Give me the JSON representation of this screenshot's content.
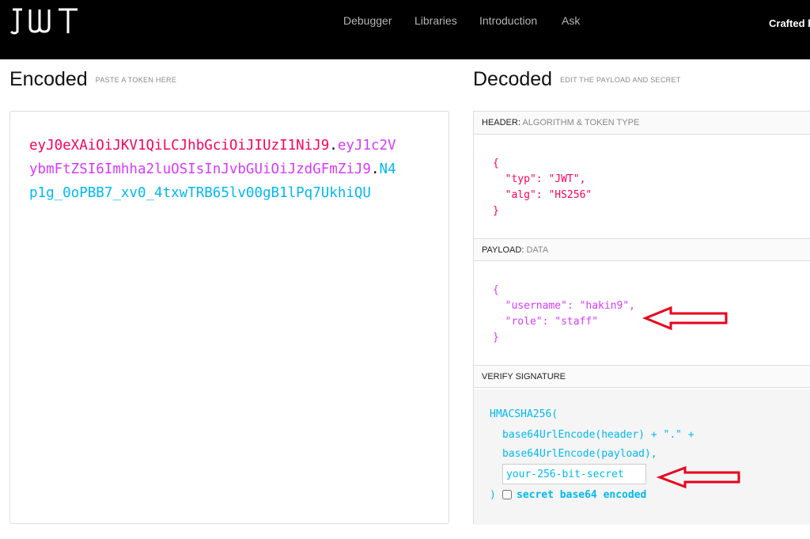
{
  "header": {
    "logo_text": "JWT",
    "nav": [
      "Debugger",
      "Libraries",
      "Introduction",
      "Ask"
    ],
    "crafted_text": "Crafted b"
  },
  "encoded": {
    "title": "Encoded",
    "subtitle": "PASTE A TOKEN HERE",
    "token_header": "eyJ0eXAiOiJKV1QiLCJhbGciOiJIUzI1NiJ9",
    "token_payload": "eyJ1c2VybmFtZSI6Imhha2luOSIsInJvbGUiOiJzdGFmZiJ9",
    "token_signature": "N4p1g_0oPBB7_xv0_4txwTRB65lv00gB1lPq7UkhiQU"
  },
  "decoded": {
    "title": "Decoded",
    "subtitle": "EDIT THE PAYLOAD AND SECRET",
    "header_panel": {
      "label": "HEADER:",
      "sublabel": "ALGORITHM & TOKEN TYPE",
      "json_text": "{\n  \"typ\": \"JWT\",\n  \"alg\": \"HS256\"\n}"
    },
    "payload_panel": {
      "label": "PAYLOAD:",
      "sublabel": "DATA",
      "json_text": "{\n  \"username\": \"hakin9\",\n  \"role\": \"staff\"\n}"
    },
    "verify_panel": {
      "label": "VERIFY SIGNATURE",
      "func": "HMACSHA256(",
      "line1": "base64UrlEncode(header) + \".\" +",
      "line2": "base64UrlEncode(payload),",
      "secret_placeholder": "your-256-bit-secret",
      "close": ")",
      "checkbox_label": "secret base64 encoded"
    }
  },
  "colors": {
    "token_header": "#fb015b",
    "token_payload": "#d63aff",
    "token_signature": "#00b9f1",
    "annotation_arrow": "#e8001c"
  }
}
